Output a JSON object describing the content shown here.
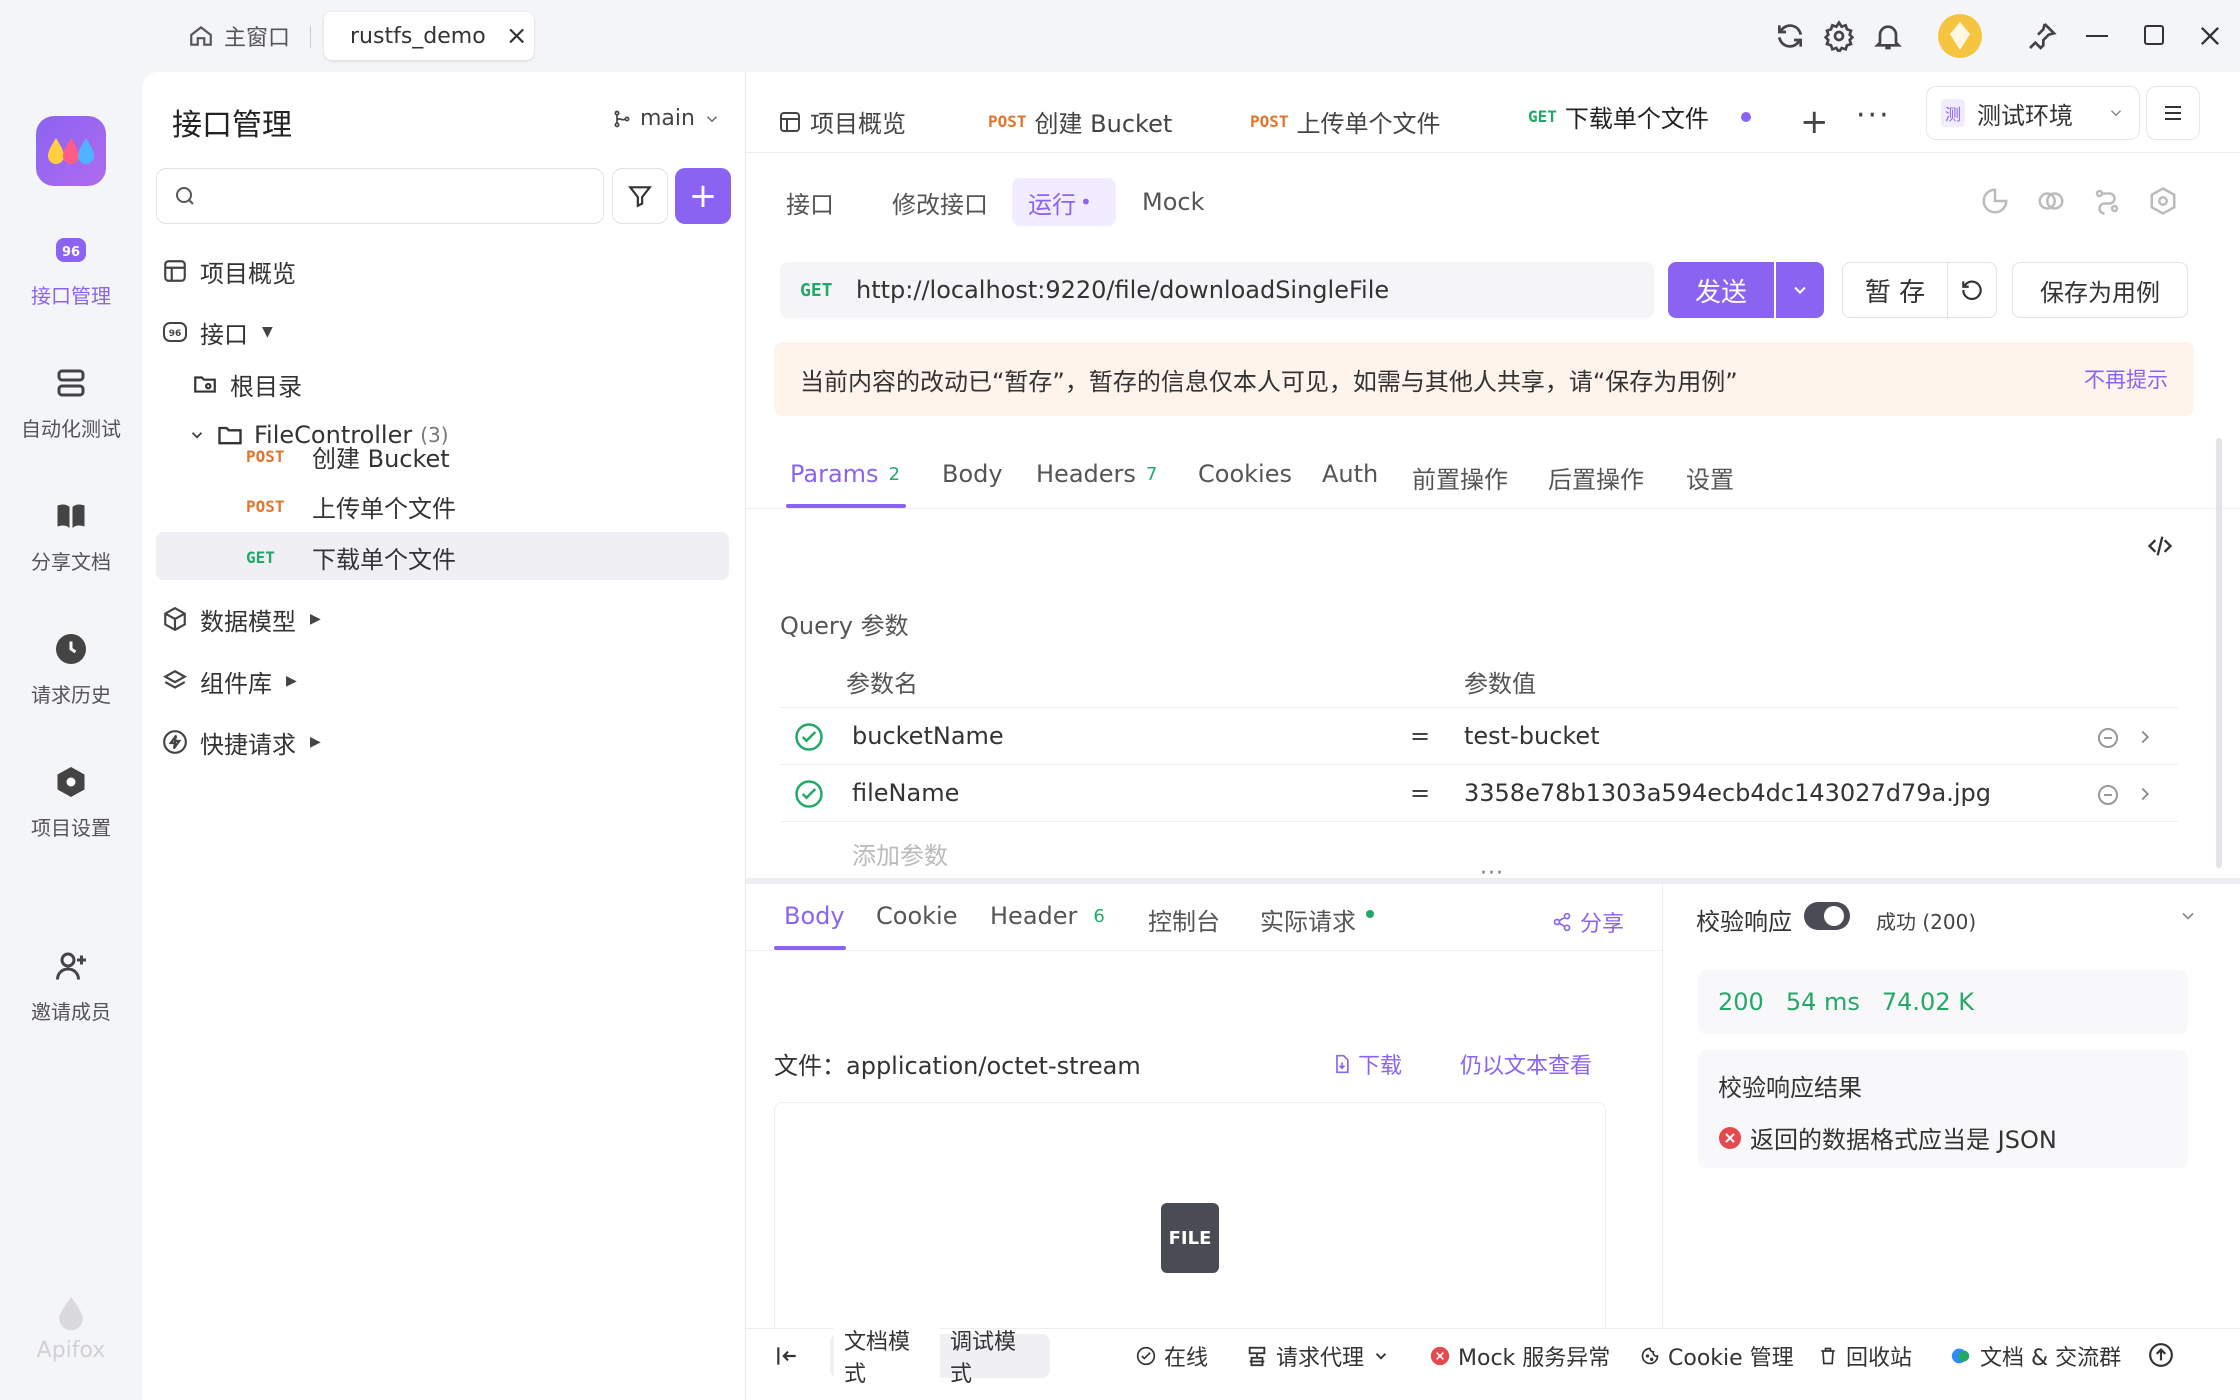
{
  "titlebar": {
    "home_tab": "主窗口",
    "project_tab": "rustfs_demo",
    "close_glyph": "×"
  },
  "rail": {
    "items": [
      {
        "label": "接口管理",
        "icon": "api-icon"
      },
      {
        "label": "自动化测试",
        "icon": "automation-icon"
      },
      {
        "label": "分享文档",
        "icon": "book-icon"
      },
      {
        "label": "请求历史",
        "icon": "clock-icon"
      },
      {
        "label": "项目设置",
        "icon": "hexagon-settings-icon"
      },
      {
        "label": "邀请成员",
        "icon": "add-user-icon"
      }
    ],
    "brand": "Apifox"
  },
  "sidebar": {
    "title": "接口管理",
    "branch": "main",
    "search_placeholder": "",
    "add_glyph": "+",
    "tree": {
      "overview": "项目概览",
      "api": "接口",
      "root": "根目录",
      "folder": "FileController",
      "folder_count": "(3)",
      "endpoints": [
        {
          "method": "POST",
          "name": "创建 Bucket"
        },
        {
          "method": "POST",
          "name": "上传单个文件"
        },
        {
          "method": "GET",
          "name": "下载单个文件"
        }
      ],
      "models": "数据模型",
      "components": "组件库",
      "quick": "快捷请求"
    }
  },
  "doc_tabs": [
    {
      "label": "项目概览"
    },
    {
      "method": "POST",
      "label": "创建 Bucket"
    },
    {
      "method": "POST",
      "label": "上传单个文件"
    },
    {
      "method": "GET",
      "label": "下载单个文件"
    }
  ],
  "env": {
    "tag": "测",
    "label": "测试环境"
  },
  "sub_tabs": {
    "api": "接口",
    "edit": "修改接口",
    "run": "运行",
    "run_dot": "•",
    "mock": "Mock"
  },
  "url_bar": {
    "method": "GET",
    "url": "http://localhost:9220/file/downloadSingleFile",
    "send": "发送",
    "save_temp": "暂 存",
    "save_case": "保存为用例"
  },
  "notice": {
    "text": "当前内容的改动已“暂存”，暂存的信息仅本人可见，如需与其他人共享，请“保存为用例”",
    "dismiss": "不再提示"
  },
  "param_tabs": [
    {
      "label": "Params",
      "badge": "2"
    },
    {
      "label": "Body",
      "badge": ""
    },
    {
      "label": "Headers",
      "badge": "7"
    },
    {
      "label": "Cookies",
      "badge": ""
    },
    {
      "label": "Auth",
      "badge": ""
    },
    {
      "label": "前置操作",
      "badge": ""
    },
    {
      "label": "后置操作",
      "badge": ""
    },
    {
      "label": "设置",
      "badge": ""
    }
  ],
  "query": {
    "title": "Query 参数",
    "col_name": "参数名",
    "col_value": "参数值",
    "eq": "=",
    "rows": [
      {
        "name": "bucketName",
        "value": "test-bucket"
      },
      {
        "name": "fileName",
        "value": "3358e78b1303a594ecb4dc143027d79a.jpg"
      }
    ],
    "add_placeholder": "添加参数"
  },
  "response": {
    "tabs": [
      {
        "label": "Body",
        "badge": ""
      },
      {
        "label": "Cookie",
        "badge": ""
      },
      {
        "label": "Header",
        "badge": "6"
      },
      {
        "label": "控制台",
        "badge": ""
      },
      {
        "label": "实际请求",
        "badge": ""
      }
    ],
    "share": "分享",
    "file_prefix": "文件：",
    "file_type": "application/octet-stream",
    "download": "下载",
    "view_text": "仍以文本查看",
    "file_icon_label": "FILE"
  },
  "validation": {
    "title": "校验响应",
    "status": "成功 (200)",
    "code": "200",
    "time": "54 ms",
    "size": "74.02 K",
    "result_title": "校验响应结果",
    "result_msg": "返回的数据格式应当是 JSON",
    "toggle_on": true
  },
  "statusbar": {
    "doc_mode": "文档模式",
    "debug_mode": "调试模式",
    "online": "在线",
    "proxy": "请求代理",
    "mock": "Mock 服务异常",
    "cookie": "Cookie 管理",
    "recycle": "回收站",
    "docs": "文档 & 交流群"
  },
  "colors": {
    "accent": "#8a63f0",
    "post": "#e2752e",
    "get": "#24a868",
    "error": "#e5484d",
    "notice_bg": "#fff4ec"
  }
}
